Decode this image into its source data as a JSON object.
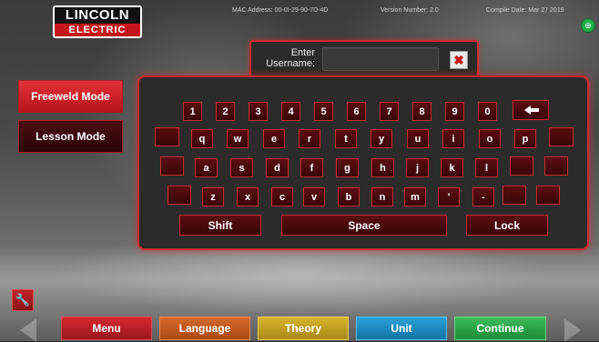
{
  "header": {
    "logo_top": "LINCOLN",
    "logo_bottom": "ELECTRIC",
    "mac_address": "MAC Address: 00-0I-29-90-7D-4D",
    "version_number": "Version Number: 2.0",
    "compile_date": "Compile Date: Mar 27 2019"
  },
  "modes": {
    "freeweld": "Freeweld Mode",
    "lesson": "Lesson Mode"
  },
  "login": {
    "label_line1": "Enter",
    "label_line2": "Username:",
    "username_value": "",
    "close_glyph": "✖"
  },
  "keyboard": {
    "row1": [
      "1",
      "2",
      "3",
      "4",
      "5",
      "6",
      "7",
      "8",
      "9",
      "0"
    ],
    "row2": [
      "q",
      "w",
      "e",
      "r",
      "t",
      "y",
      "u",
      "i",
      "o",
      "p"
    ],
    "row3": [
      "a",
      "s",
      "d",
      "f",
      "g",
      "h",
      "j",
      "k",
      "l"
    ],
    "row4": [
      "z",
      "x",
      "c",
      "v",
      "b",
      "n",
      "m",
      "'",
      "-"
    ],
    "shift": "Shift",
    "space": "Space",
    "lock": "Lock"
  },
  "bottom_nav": {
    "menu": "Menu",
    "language": "Language",
    "theory": "Theory",
    "unit": "Unit",
    "continue": "Continue"
  },
  "colors": {
    "accent_red": "#d12a30",
    "menu": "#b01a22",
    "language": "#c45a1a",
    "theory": "#c9a51f",
    "unit": "#1a8fc4",
    "continue": "#2ea64a"
  }
}
